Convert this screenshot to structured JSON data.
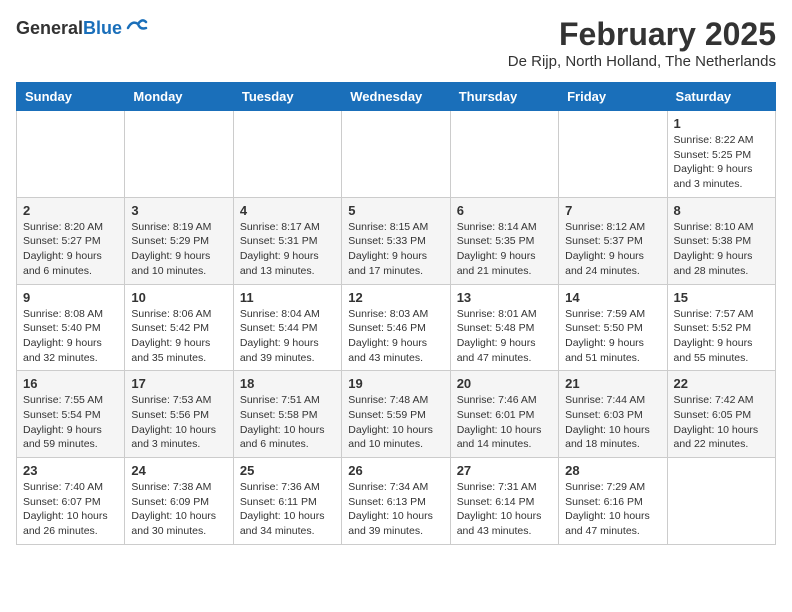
{
  "header": {
    "logo_general": "General",
    "logo_blue": "Blue",
    "month_title": "February 2025",
    "location": "De Rijp, North Holland, The Netherlands"
  },
  "days_of_week": [
    "Sunday",
    "Monday",
    "Tuesday",
    "Wednesday",
    "Thursday",
    "Friday",
    "Saturday"
  ],
  "weeks": [
    [
      {
        "day": "",
        "info": ""
      },
      {
        "day": "",
        "info": ""
      },
      {
        "day": "",
        "info": ""
      },
      {
        "day": "",
        "info": ""
      },
      {
        "day": "",
        "info": ""
      },
      {
        "day": "",
        "info": ""
      },
      {
        "day": "1",
        "info": "Sunrise: 8:22 AM\nSunset: 5:25 PM\nDaylight: 9 hours and 3 minutes."
      }
    ],
    [
      {
        "day": "2",
        "info": "Sunrise: 8:20 AM\nSunset: 5:27 PM\nDaylight: 9 hours and 6 minutes."
      },
      {
        "day": "3",
        "info": "Sunrise: 8:19 AM\nSunset: 5:29 PM\nDaylight: 9 hours and 10 minutes."
      },
      {
        "day": "4",
        "info": "Sunrise: 8:17 AM\nSunset: 5:31 PM\nDaylight: 9 hours and 13 minutes."
      },
      {
        "day": "5",
        "info": "Sunrise: 8:15 AM\nSunset: 5:33 PM\nDaylight: 9 hours and 17 minutes."
      },
      {
        "day": "6",
        "info": "Sunrise: 8:14 AM\nSunset: 5:35 PM\nDaylight: 9 hours and 21 minutes."
      },
      {
        "day": "7",
        "info": "Sunrise: 8:12 AM\nSunset: 5:37 PM\nDaylight: 9 hours and 24 minutes."
      },
      {
        "day": "8",
        "info": "Sunrise: 8:10 AM\nSunset: 5:38 PM\nDaylight: 9 hours and 28 minutes."
      }
    ],
    [
      {
        "day": "9",
        "info": "Sunrise: 8:08 AM\nSunset: 5:40 PM\nDaylight: 9 hours and 32 minutes."
      },
      {
        "day": "10",
        "info": "Sunrise: 8:06 AM\nSunset: 5:42 PM\nDaylight: 9 hours and 35 minutes."
      },
      {
        "day": "11",
        "info": "Sunrise: 8:04 AM\nSunset: 5:44 PM\nDaylight: 9 hours and 39 minutes."
      },
      {
        "day": "12",
        "info": "Sunrise: 8:03 AM\nSunset: 5:46 PM\nDaylight: 9 hours and 43 minutes."
      },
      {
        "day": "13",
        "info": "Sunrise: 8:01 AM\nSunset: 5:48 PM\nDaylight: 9 hours and 47 minutes."
      },
      {
        "day": "14",
        "info": "Sunrise: 7:59 AM\nSunset: 5:50 PM\nDaylight: 9 hours and 51 minutes."
      },
      {
        "day": "15",
        "info": "Sunrise: 7:57 AM\nSunset: 5:52 PM\nDaylight: 9 hours and 55 minutes."
      }
    ],
    [
      {
        "day": "16",
        "info": "Sunrise: 7:55 AM\nSunset: 5:54 PM\nDaylight: 9 hours and 59 minutes."
      },
      {
        "day": "17",
        "info": "Sunrise: 7:53 AM\nSunset: 5:56 PM\nDaylight: 10 hours and 3 minutes."
      },
      {
        "day": "18",
        "info": "Sunrise: 7:51 AM\nSunset: 5:58 PM\nDaylight: 10 hours and 6 minutes."
      },
      {
        "day": "19",
        "info": "Sunrise: 7:48 AM\nSunset: 5:59 PM\nDaylight: 10 hours and 10 minutes."
      },
      {
        "day": "20",
        "info": "Sunrise: 7:46 AM\nSunset: 6:01 PM\nDaylight: 10 hours and 14 minutes."
      },
      {
        "day": "21",
        "info": "Sunrise: 7:44 AM\nSunset: 6:03 PM\nDaylight: 10 hours and 18 minutes."
      },
      {
        "day": "22",
        "info": "Sunrise: 7:42 AM\nSunset: 6:05 PM\nDaylight: 10 hours and 22 minutes."
      }
    ],
    [
      {
        "day": "23",
        "info": "Sunrise: 7:40 AM\nSunset: 6:07 PM\nDaylight: 10 hours and 26 minutes."
      },
      {
        "day": "24",
        "info": "Sunrise: 7:38 AM\nSunset: 6:09 PM\nDaylight: 10 hours and 30 minutes."
      },
      {
        "day": "25",
        "info": "Sunrise: 7:36 AM\nSunset: 6:11 PM\nDaylight: 10 hours and 34 minutes."
      },
      {
        "day": "26",
        "info": "Sunrise: 7:34 AM\nSunset: 6:13 PM\nDaylight: 10 hours and 39 minutes."
      },
      {
        "day": "27",
        "info": "Sunrise: 7:31 AM\nSunset: 6:14 PM\nDaylight: 10 hours and 43 minutes."
      },
      {
        "day": "28",
        "info": "Sunrise: 7:29 AM\nSunset: 6:16 PM\nDaylight: 10 hours and 47 minutes."
      },
      {
        "day": "",
        "info": ""
      }
    ]
  ]
}
